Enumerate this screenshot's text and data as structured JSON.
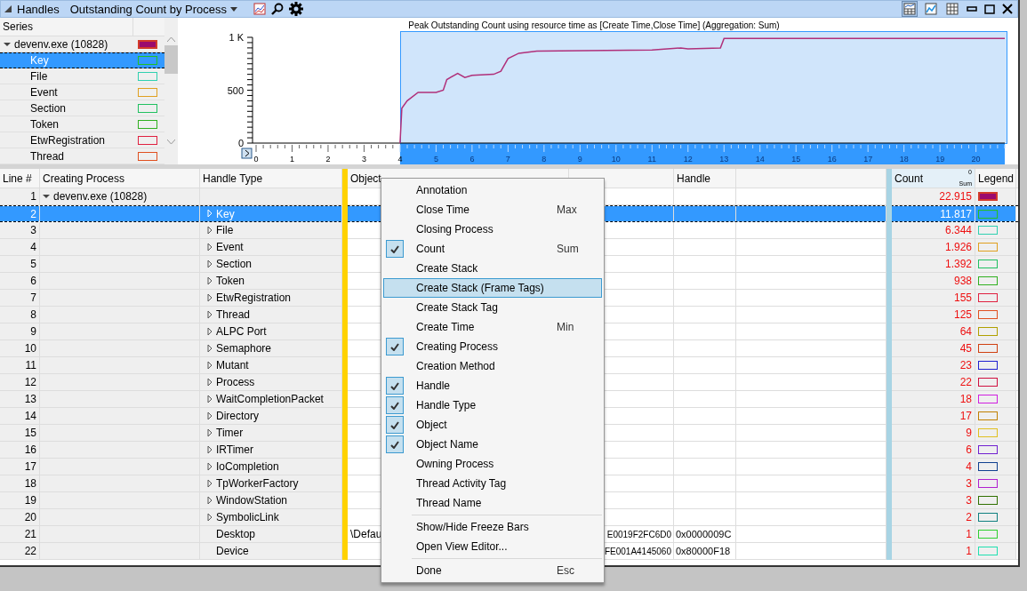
{
  "title_bar": {
    "title": "Handles",
    "view_preset": "Outstanding Count by Process"
  },
  "series_panel": {
    "header": "Series",
    "items": [
      {
        "label": "devenv.exe (10828)",
        "expanded": true,
        "kind": "process",
        "color": "#9b0a6e",
        "selected": false,
        "children": [
          {
            "label": "Key",
            "color": "#22c022",
            "selected": true
          },
          {
            "label": "File",
            "color": "#30d0b0",
            "selected": false
          },
          {
            "label": "Event",
            "color": "#e0a020",
            "selected": false
          },
          {
            "label": "Section",
            "color": "#20c060",
            "selected": false
          },
          {
            "label": "Token",
            "color": "#30b020",
            "selected": false
          },
          {
            "label": "EtwRegistration",
            "color": "#e02040",
            "selected": false
          },
          {
            "label": "Thread",
            "color": "#e05020",
            "selected": false
          }
        ]
      }
    ]
  },
  "chart": {
    "chart_data": {
      "type": "line",
      "title": "Peak Outstanding Count using resource time as [Create Time,Close Time] (Aggregation: Sum)",
      "xlim": [
        0,
        20.8
      ],
      "ylim": [
        0,
        1000
      ],
      "xticks": [
        0,
        1,
        2,
        3,
        4,
        5,
        6,
        7,
        8,
        9,
        10,
        11,
        12,
        13,
        14,
        15,
        16,
        17,
        18,
        19,
        20
      ],
      "yticks": [
        0,
        500,
        {
          "value": 1000,
          "label": "1 K"
        }
      ],
      "x": [
        4,
        4.05,
        4.2,
        4.5,
        5.0,
        5.2,
        5.3,
        5.6,
        5.8,
        6.0,
        6.6,
        6.8,
        7.0,
        7.3,
        7.8,
        11,
        11.8,
        12.0,
        12.9,
        13.0,
        14.2,
        20.8
      ],
      "series": [
        {
          "color": "#b0307a",
          "values": [
            0,
            330,
            400,
            480,
            480,
            500,
            600,
            660,
            620,
            640,
            650,
            680,
            800,
            850,
            870,
            880,
            900,
            890,
            900,
            990,
            990,
            990
          ]
        }
      ]
    }
  },
  "table": {
    "columns": [
      {
        "label": "Line #",
        "kind": "text"
      },
      {
        "label": "Creating Process",
        "kind": "text"
      },
      {
        "label": "Handle Type",
        "kind": "text"
      },
      {
        "kind": "freeze",
        "color": "#ffd200"
      },
      {
        "label": "Object",
        "kind": "text"
      },
      {
        "kind": "text"
      },
      {
        "label": "Handle",
        "kind": "text"
      },
      {
        "kind": "text"
      },
      {
        "kind": "freeze",
        "color": "#a8d4e4"
      },
      {
        "label": "Count",
        "kind": "count",
        "sort_order": "0",
        "aggregation": "Sum"
      },
      {
        "label": "Legend",
        "kind": "text"
      }
    ],
    "rows": [
      {
        "line": "1",
        "creating_process": "devenv.exe (10828)",
        "expanded": true,
        "count": "22.915",
        "kind": "process",
        "color": "#9b0a6e",
        "selected": false,
        "children": [
          {
            "line": "2",
            "handle_type": "Key",
            "kind": "group",
            "expanded": false,
            "count": "11.817",
            "color": "#22c022",
            "selected": true
          },
          {
            "line": "3",
            "handle_type": "File",
            "kind": "group",
            "expanded": false,
            "count": "6.344",
            "color": "#30d0b0",
            "selected": false
          },
          {
            "line": "4",
            "handle_type": "Event",
            "kind": "group",
            "expanded": false,
            "count": "1.926",
            "color": "#e0a020",
            "selected": false
          },
          {
            "line": "5",
            "handle_type": "Section",
            "kind": "group",
            "expanded": false,
            "count": "1.392",
            "color": "#20c060",
            "selected": false
          },
          {
            "line": "6",
            "handle_type": "Token",
            "kind": "group",
            "expanded": false,
            "count": "938",
            "color": "#30b020",
            "selected": false
          },
          {
            "line": "7",
            "handle_type": "EtwRegistration",
            "kind": "group",
            "expanded": false,
            "count": "155",
            "color": "#e02040",
            "selected": false
          },
          {
            "line": "8",
            "handle_type": "Thread",
            "kind": "group",
            "expanded": false,
            "count": "125",
            "color": "#e05020",
            "selected": false
          },
          {
            "line": "9",
            "handle_type": "ALPC Port",
            "kind": "group",
            "expanded": false,
            "count": "64",
            "color": "#b0a000",
            "selected": false
          },
          {
            "line": "10",
            "handle_type": "Semaphore",
            "kind": "group",
            "expanded": false,
            "count": "45",
            "color": "#d04010",
            "selected": false
          },
          {
            "line": "11",
            "handle_type": "Mutant",
            "kind": "group",
            "expanded": false,
            "count": "23",
            "color": "#2020d0",
            "selected": false
          },
          {
            "line": "12",
            "handle_type": "Process",
            "kind": "group",
            "expanded": false,
            "count": "22",
            "color": "#d01040",
            "selected": false
          },
          {
            "line": "13",
            "handle_type": "WaitCompletionPacket",
            "kind": "group",
            "expanded": false,
            "count": "18",
            "color": "#d020e0",
            "selected": false
          },
          {
            "line": "14",
            "handle_type": "Directory",
            "kind": "group",
            "expanded": false,
            "count": "17",
            "color": "#c08000",
            "selected": false
          },
          {
            "line": "15",
            "handle_type": "Timer",
            "kind": "group",
            "expanded": false,
            "count": "9",
            "color": "#e0c020",
            "selected": false
          },
          {
            "line": "16",
            "handle_type": "IRTimer",
            "kind": "group",
            "expanded": false,
            "count": "6",
            "color": "#7020d0",
            "selected": false
          },
          {
            "line": "17",
            "handle_type": "IoCompletion",
            "kind": "group",
            "expanded": false,
            "count": "4",
            "color": "#104090",
            "selected": false
          },
          {
            "line": "18",
            "handle_type": "TpWorkerFactory",
            "kind": "group",
            "expanded": false,
            "count": "3",
            "color": "#b020d0",
            "selected": false
          },
          {
            "line": "19",
            "handle_type": "WindowStation",
            "kind": "group",
            "expanded": false,
            "count": "3",
            "color": "#307000",
            "selected": false
          },
          {
            "line": "20",
            "handle_type": "SymbolicLink",
            "kind": "group",
            "expanded": false,
            "count": "2",
            "color": "#108080",
            "selected": false
          },
          {
            "line": "21",
            "handle_type": "Desktop",
            "kind": "leaf",
            "object_name": "\\Defau",
            "object": "E0019F2FC6D0",
            "handle": "0x0000009C",
            "count": "1",
            "color": "#30d030",
            "selected": false
          },
          {
            "line": "22",
            "handle_type": "Device",
            "kind": "leaf",
            "object": "FE001A4145060",
            "handle": "0x80000F18",
            "count": "1",
            "color": "#20e0b0",
            "selected": false
          }
        ]
      }
    ]
  },
  "context_menu": {
    "sections": [
      [
        {
          "label": "Annotation",
          "checked": false,
          "selected": false
        },
        {
          "label": "Close Time",
          "hint": "Max",
          "checked": false,
          "selected": false
        },
        {
          "label": "Closing Process",
          "checked": false,
          "selected": false
        },
        {
          "label": "Count",
          "hint": "Sum",
          "checked": true,
          "selected": false
        },
        {
          "label": "Create Stack",
          "checked": false,
          "selected": false
        },
        {
          "label": "Create Stack (Frame Tags)",
          "checked": false,
          "selected": true
        },
        {
          "label": "Create Stack Tag",
          "checked": false,
          "selected": false
        },
        {
          "label": "Create Time",
          "hint": "Min",
          "checked": false,
          "selected": false
        },
        {
          "label": "Creating Process",
          "checked": true,
          "selected": false
        },
        {
          "label": "Creation Method",
          "checked": false,
          "selected": false
        },
        {
          "label": "Handle",
          "checked": true,
          "selected": false
        },
        {
          "label": "Handle Type",
          "checked": true,
          "selected": false
        },
        {
          "label": "Object",
          "checked": true,
          "selected": false
        },
        {
          "label": "Object Name",
          "checked": true,
          "selected": false
        },
        {
          "label": "Owning Process",
          "checked": false,
          "selected": false
        },
        {
          "label": "Thread Activity Tag",
          "checked": false,
          "selected": false
        },
        {
          "label": "Thread Name",
          "checked": false,
          "selected": false
        }
      ],
      [
        {
          "label": "Show/Hide Freeze Bars",
          "checked": false,
          "selected": false
        },
        {
          "label": "Open View Editor...",
          "checked": false,
          "selected": false
        }
      ],
      [
        {
          "label": "Done",
          "hint": "Esc",
          "checked": false,
          "selected": false
        }
      ]
    ]
  }
}
